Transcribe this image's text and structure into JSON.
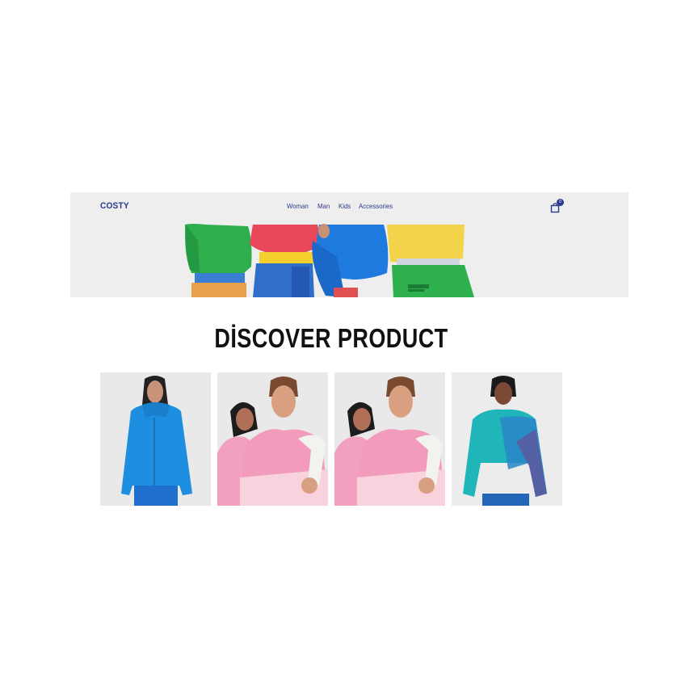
{
  "brand": {
    "name": "COSTY"
  },
  "nav": {
    "items": [
      {
        "label": "Woman"
      },
      {
        "label": "Man"
      },
      {
        "label": "Kids"
      },
      {
        "label": "Accessories"
      }
    ]
  },
  "cart": {
    "icon": "shopping-bag-icon",
    "count": "0"
  },
  "section": {
    "title": "DİSCOVER PRODUCT"
  },
  "products": [
    {
      "name": "blue-puffer-jacket",
      "color": "#1e8fe0"
    },
    {
      "name": "pink-tie-dye-hoodie",
      "color": "#f29bbc"
    },
    {
      "name": "pink-tie-dye-hoodie",
      "color": "#f29bbc"
    },
    {
      "name": "teal-tie-dye-sweatshirt",
      "color": "#20b5b9"
    }
  ],
  "colors": {
    "accent": "#2b3a8c",
    "hero_bg": "#efeeee",
    "title": "#111111"
  }
}
